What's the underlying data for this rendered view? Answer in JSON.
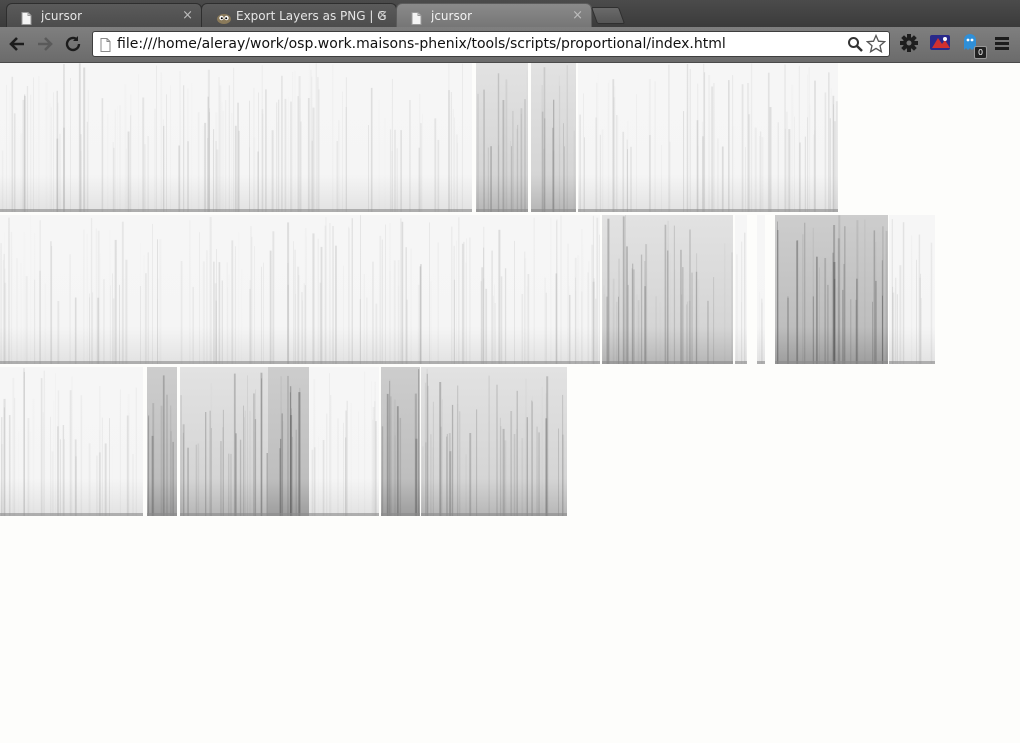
{
  "tabs": [
    {
      "title": "jcursor",
      "icon": "page-icon",
      "close": "×",
      "active": false
    },
    {
      "title": "Export Layers as PNG | GI",
      "icon": "gimp-icon",
      "close": "×",
      "active": false
    },
    {
      "title": "jcursor",
      "icon": "page-icon",
      "close": "×",
      "active": true
    }
  ],
  "omnibox": {
    "url": "file:///home/aleray/work/osp.work.maisons-phenix/tools/scripts/proportional/index.html"
  },
  "extensions": {
    "badge_count": "0"
  },
  "page": {
    "spectrograms": [
      {
        "row": 1,
        "index": 1,
        "tone": "light"
      },
      {
        "row": 1,
        "index": 2,
        "tone": "medium"
      },
      {
        "row": 1,
        "index": 3,
        "tone": "medium"
      },
      {
        "row": 1,
        "index": 4,
        "tone": "light"
      },
      {
        "row": 2,
        "index": 1,
        "tone": "light"
      },
      {
        "row": 2,
        "index": 2,
        "tone": "medium"
      },
      {
        "row": 2,
        "index": 3,
        "tone": "light"
      },
      {
        "row": 2,
        "index": 4,
        "tone": "light"
      },
      {
        "row": 2,
        "index": 5,
        "tone": "dark"
      },
      {
        "row": 2,
        "index": 6,
        "tone": "light"
      },
      {
        "row": 3,
        "index": 1,
        "tone": "light"
      },
      {
        "row": 3,
        "index": 2,
        "tone": "dark"
      },
      {
        "row": 3,
        "index": 3,
        "tone": "medium"
      },
      {
        "row": 3,
        "index": 4,
        "tone": "dark"
      },
      {
        "row": 3,
        "index": 5,
        "tone": "light"
      },
      {
        "row": 3,
        "index": 6,
        "tone": "dark"
      },
      {
        "row": 3,
        "index": 7,
        "tone": "medium"
      }
    ]
  }
}
